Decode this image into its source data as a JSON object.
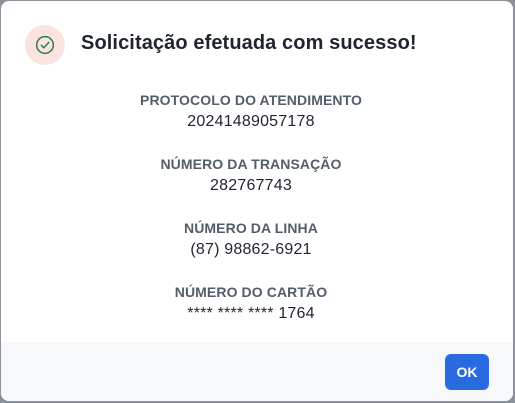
{
  "dialog": {
    "title": "Solicitação efetuada com sucesso!",
    "icon": "check-circle-icon",
    "icon_color": "#2e7d4f",
    "icon_bg": "#fbe3e1"
  },
  "details": [
    {
      "label": "PROTOCOLO DO ATENDIMENTO",
      "value": "20241489057178"
    },
    {
      "label": "NÚMERO DA TRANSAÇÃO",
      "value": "282767743"
    },
    {
      "label": "NÚMERO DA LINHA",
      "value": "(87) 98862-6921"
    },
    {
      "label": "NÚMERO DO CARTÃO",
      "value": "**** **** **** 1764"
    }
  ],
  "footer": {
    "ok_label": "OK",
    "ok_color": "#2a6ae0"
  }
}
